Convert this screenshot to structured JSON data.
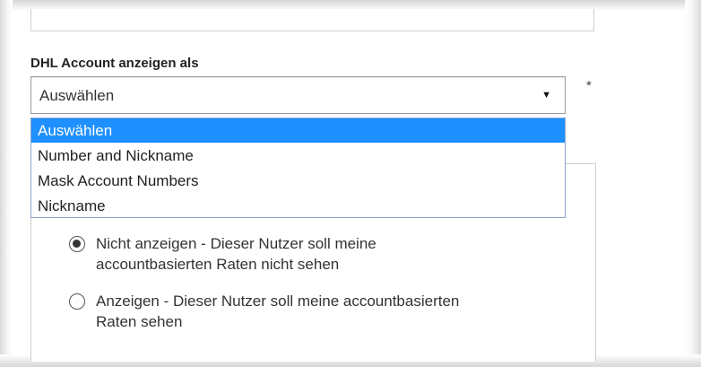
{
  "form": {
    "account_display": {
      "label": "DHL Account anzeigen als",
      "required_marker": "*",
      "selected_value": "Auswählen",
      "options": [
        "Auswählen",
        "Number and Nickname",
        "Mask Account Numbers",
        "Nickname"
      ],
      "highlighted_option": "Auswählen"
    },
    "rates_visibility": {
      "options": [
        {
          "label_line1": "Nicht anzeigen - Dieser Nutzer soll meine",
          "label_line2": "accountbasierten Raten nicht sehen",
          "checked": true
        },
        {
          "label_line1": "Anzeigen - Dieser Nutzer soll meine accountbasierten",
          "label_line2": "Raten sehen",
          "checked": false
        }
      ]
    }
  },
  "colors": {
    "highlight": "#1e90ff",
    "highlight_text": "#ffffff",
    "border": "#9a9a9a"
  },
  "icons": {
    "select_arrow": "caret-down-icon"
  }
}
